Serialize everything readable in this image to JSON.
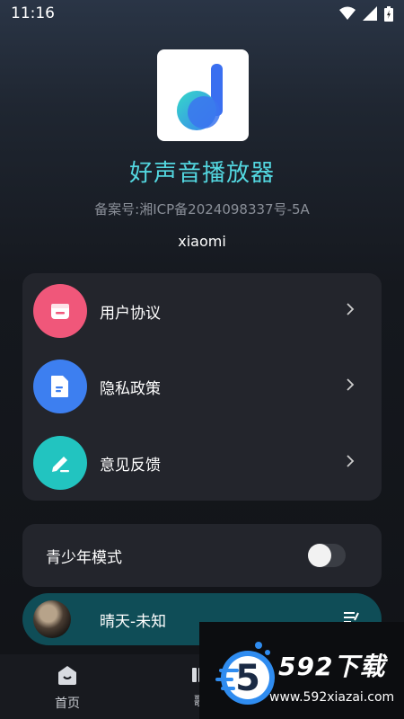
{
  "status_bar": {
    "time": "11:16",
    "icons": [
      "wifi-icon",
      "signal-icon",
      "battery-icon"
    ]
  },
  "app": {
    "name": "好声音播放器",
    "record_number": "备案号:湘ICP备2024098337号-5A",
    "username": "xiaomi",
    "accent_color": "#53d7e0"
  },
  "menu": {
    "items": [
      {
        "label": "用户协议",
        "icon": "calendar-icon",
        "color": "#f0577a"
      },
      {
        "label": "隐私政策",
        "icon": "document-icon",
        "color": "#3d7ff0"
      },
      {
        "label": "意见反馈",
        "icon": "pen-icon",
        "color": "#22c4c0"
      }
    ]
  },
  "teen_mode": {
    "label": "青少年模式",
    "enabled": false
  },
  "player": {
    "track": "晴天-未知"
  },
  "bottom_nav": {
    "items": [
      {
        "label": "首页",
        "icon": "home-icon"
      },
      {
        "label": "歌",
        "icon": "music-icon"
      }
    ]
  },
  "watermark": {
    "logo_text": "5",
    "title": "592下载",
    "url": "www.592xiazai.com"
  }
}
